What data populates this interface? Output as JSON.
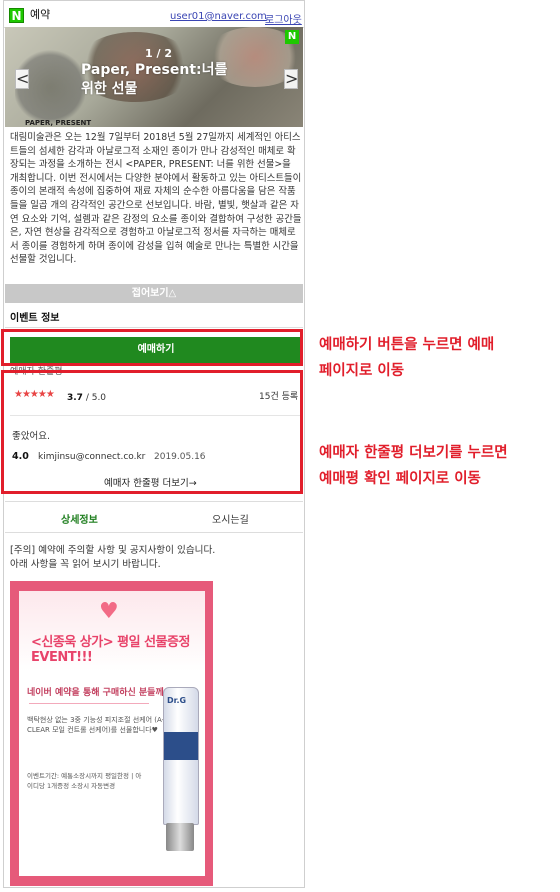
{
  "header": {
    "logo": "N",
    "title": "예약",
    "user": "user01@naver.com",
    "logout": "로그아웃"
  },
  "banner": {
    "counter": "1 / 2",
    "title": "Paper, Present:너를 위한 선물",
    "prev": "<",
    "next": ">",
    "badge": "N",
    "caption": "PAPER, PRESENT"
  },
  "description": "대림미술관은 오는 12월 7일부터 2018년 5월 27일까지 세계적인 아티스트들의 섬세한 감각과 아날로그적 소재인 종이가 만나 감성적인 매체로 확장되는 과정을 소개하는 전시 <PAPER, PRESENT: 너를 위한 선물>을 개최합니다. 이번 전시에서는 다양한 분야에서 활동하고 있는 아티스트들이 종이의 본래적 속성에 집중하여 재료 자체의 순수한 아름다움을 담은 작품들을 일곱 개의 감각적인 공간으로 선보입니다. 바람, 별빛, 햇살과 같은 자연 요소와 기억, 설렘과 같은 감정의 요소를 종이와 결합하여 구성한 공간들은, 자연 현상을 감각적으로 경험하고 아날로그적 정서를 자극하는 매체로서 종이를 경험하게 하며 종이에 감성을 입혀 예술로 만나는 특별한 시간을 선물할 것입니다.",
  "fold_label": "접어보기△",
  "event_info_label": "이벤트 정보",
  "booking_button": "예매하기",
  "reviews": {
    "header": "예매자 한줄평",
    "stars": "★★★★★",
    "average": "3.7",
    "max": "/ 5.0",
    "count": "15건 등록",
    "items": [
      {
        "text": "좋았어요.",
        "score": "4.0",
        "user": "kimjinsu@connect.co.kr",
        "date": "2019.05.16"
      }
    ],
    "more": "예매자 한줄평 더보기→"
  },
  "tabs": [
    {
      "label": "상세정보",
      "active": true
    },
    {
      "label": "오시는길",
      "active": false
    }
  ],
  "notice": {
    "line1": "[주의] 예약에 주의할 사항 및 공지사항이 있습니다.",
    "line2": "아래 사항을 꼭 읽어 보시기 바랍니다."
  },
  "promo": {
    "title": "<신종욱 상가> 평일 선물증정 EVENT!!!",
    "subtitle": "네이버 예약을 통해 구매하신 분들께,",
    "desc": "백탁현상 없는 3중 기능성 피지조절 선케어 (A-CLEAR 모일 컨트롤 선케어)를 선물합니다♥",
    "foot": "이벤트기간: 예통소장시까지 평일한정 | 아이디당 1개증정 소장시 자동변경",
    "product": "Dr.G"
  },
  "annotations": {
    "booking_note": "예매하기 버튼을 누르면 예매\n페이지로 이동",
    "review_note": "예매자 한줄평 더보기를 누르면\n예매평 확인 페이지로 이동"
  },
  "colors": {
    "brand_green": "#1ec800",
    "booking_green": "#20891f",
    "callout_red": "#e11e2b",
    "star_red": "#e84545",
    "promo_pink": "#e65a7a"
  }
}
